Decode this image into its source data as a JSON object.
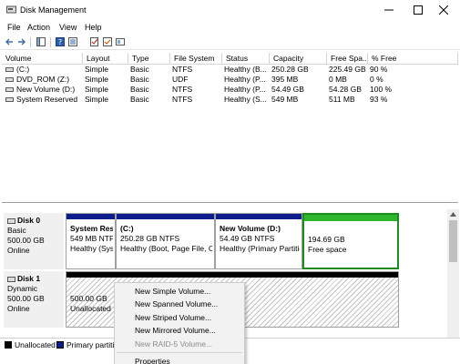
{
  "window": {
    "title": "Disk Management"
  },
  "menu": [
    "File",
    "Action",
    "View",
    "Help"
  ],
  "table": {
    "headers": [
      "Volume",
      "Layout",
      "Type",
      "File System",
      "Status",
      "Capacity",
      "Free Spa...",
      "% Free"
    ],
    "rows": [
      [
        "(C:)",
        "Simple",
        "Basic",
        "NTFS",
        "Healthy (B...",
        "250.28 GB",
        "225.49 GB",
        "90 %"
      ],
      [
        "DVD_ROM (Z:)",
        "Simple",
        "Basic",
        "UDF",
        "Healthy (P...",
        "395 MB",
        "0 MB",
        "0 %"
      ],
      [
        "New Volume (D:)",
        "Simple",
        "Basic",
        "NTFS",
        "Healthy (P...",
        "54.49 GB",
        "54.28 GB",
        "100 %"
      ],
      [
        "System Reserved",
        "Simple",
        "Basic",
        "NTFS",
        "Healthy (S...",
        "549 MB",
        "511 MB",
        "93 %"
      ]
    ]
  },
  "disk0": {
    "name": "Disk 0",
    "type": "Basic",
    "size": "500.00 GB",
    "status": "Online",
    "partitions": [
      {
        "name": "System Res",
        "size": "549 MB NTFS",
        "status": "Healthy (Sys"
      },
      {
        "name": "(C:)",
        "size": "250.28 GB NTFS",
        "status": "Healthy (Boot, Page File, Cra"
      },
      {
        "name": "New Volume  (D:)",
        "size": "54.49 GB NTFS",
        "status": "Healthy (Primary Partitic"
      },
      {
        "name": "",
        "size": "194.69 GB",
        "status": "Free space"
      }
    ]
  },
  "disk1": {
    "name": "Disk 1",
    "type": "Dynamic",
    "size": "500.00 GB",
    "status": "Online",
    "unallocated": {
      "size": "500.00 GB",
      "status": "Unallocated"
    }
  },
  "legend": {
    "unallocated": "Unallocated",
    "primary": "Primary partitic"
  },
  "context_menu": {
    "items": [
      "New Simple Volume...",
      "New Spanned Volume...",
      "New Striped Volume...",
      "New Mirrored Volume...",
      "New RAID-5 Volume...",
      "Properties"
    ],
    "disabled": [
      "New RAID-5 Volume..."
    ]
  },
  "colors": {
    "primary_partition": "#0e1d8c",
    "free_space": "#2db52d",
    "unallocated": "#000000"
  }
}
